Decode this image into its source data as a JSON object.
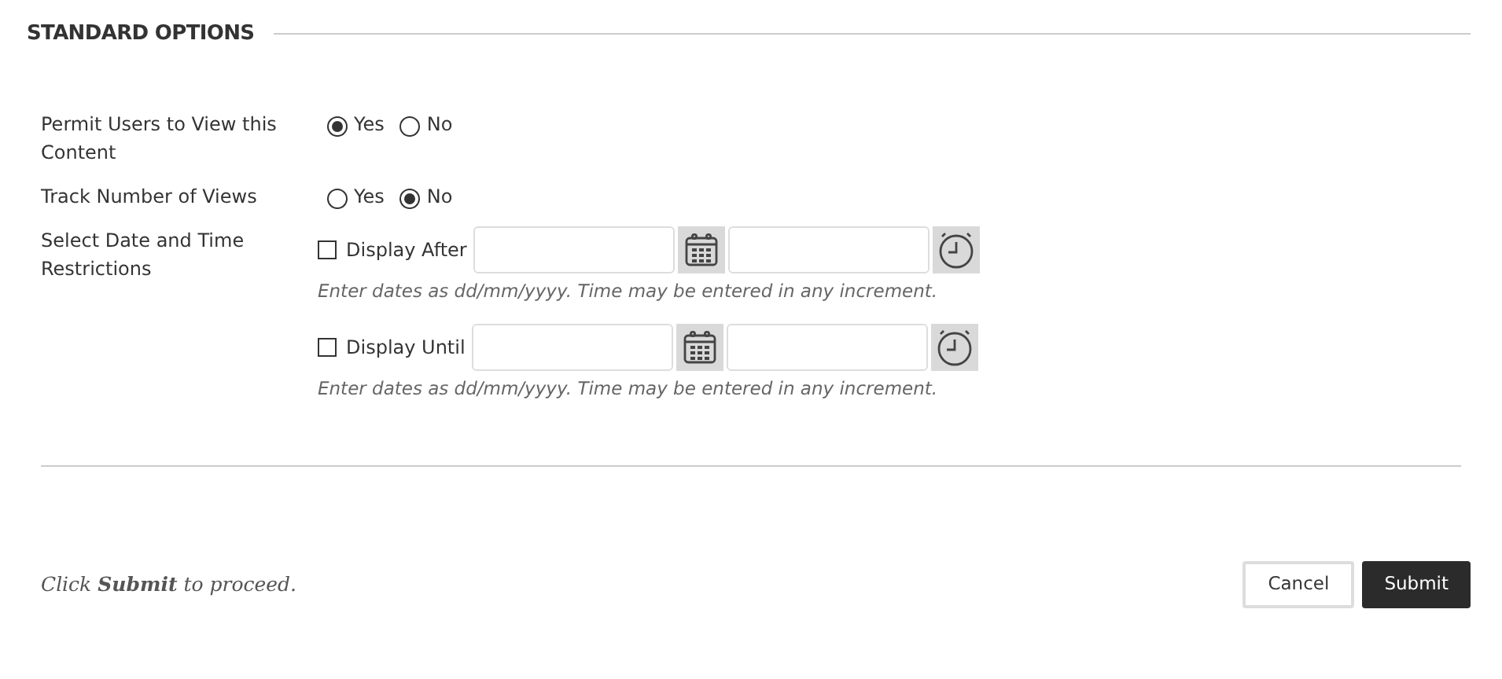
{
  "section_title": "STANDARD OPTIONS",
  "radio_rows": [
    {
      "label": "Permit Users to View this Content",
      "options": [
        {
          "label": "Yes",
          "selected": true
        },
        {
          "label": "No",
          "selected": false
        }
      ]
    },
    {
      "label": "Track Number of Views",
      "options": [
        {
          "label": "Yes",
          "selected": false
        },
        {
          "label": "No",
          "selected": true
        }
      ]
    }
  ],
  "date_restrictions": {
    "label": "Select Date and Time Restrictions",
    "rows": [
      {
        "label": "Display After",
        "checked": false,
        "hint": "Enter dates as dd/mm/yyyy. Time may be entered in any increment."
      },
      {
        "label": "Display Until",
        "checked": false,
        "hint": "Enter dates as dd/mm/yyyy. Time may be entered in any increment."
      }
    ]
  },
  "footer": {
    "instruction": "Click **Submit** to proceed.",
    "buttons": [
      {
        "label": "Cancel",
        "kind": "secondary"
      },
      {
        "label": "Submit",
        "kind": "primary"
      }
    ]
  }
}
